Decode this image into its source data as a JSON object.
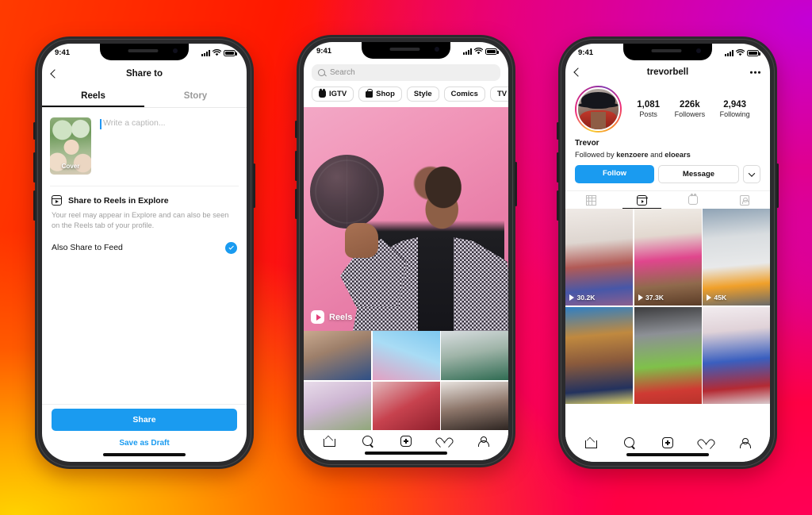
{
  "background": {
    "colors": [
      "#ff3b00",
      "#ff1800",
      "#fa0050",
      "#e5009a",
      "#bc00d4",
      "#ffd200"
    ]
  },
  "accent": {
    "blue": "#1a9bf0",
    "ig_gradient": [
      "#f9ce34",
      "#ee2a7b",
      "#bc2a8d",
      "#8134af",
      "#f58529"
    ]
  },
  "status_bar": {
    "time": "9:41",
    "signal_icon": "cellular-bars-icon",
    "wifi_icon": "wifi-icon",
    "battery_icon": "battery-icon"
  },
  "phone1": {
    "nav": {
      "back_icon": "chevron-left-icon",
      "title": "Share to"
    },
    "tabs": [
      {
        "label": "Reels",
        "active": true
      },
      {
        "label": "Story",
        "active": false
      }
    ],
    "composer": {
      "cover_label": "Cover",
      "caption_placeholder": "Write a caption...",
      "caption_value": ""
    },
    "explore": {
      "icon": "reels-icon",
      "title": "Share to Reels in Explore",
      "description": "Your reel may appear in Explore and can also be seen on the Reels tab of your profile."
    },
    "feed_option": {
      "label": "Also Share to Feed",
      "checked": true,
      "check_icon": "check-circle-icon"
    },
    "actions": {
      "primary": "Share",
      "secondary": "Save as Draft"
    }
  },
  "phone2": {
    "search": {
      "placeholder": "Search",
      "value": "",
      "icon": "search-icon"
    },
    "chips": [
      {
        "label": "IGTV",
        "icon": "igtv-icon"
      },
      {
        "label": "Shop",
        "icon": "shopping-bag-icon"
      },
      {
        "label": "Style",
        "icon": ""
      },
      {
        "label": "Comics",
        "icon": ""
      },
      {
        "label": "TV & Movies",
        "icon": ""
      }
    ],
    "hero": {
      "badge_label": "Reels",
      "badge_icon": "reels-icon",
      "alt": "person spinning a basketball on a pink background"
    },
    "explore_grid": [
      {
        "alt": "two people writing at a table"
      },
      {
        "alt": "hand with rainbow glitter against blue sky"
      },
      {
        "alt": "person in green beanie and sunglasses"
      },
      {
        "alt": "pastel flower arrangement"
      },
      {
        "alt": "red fabric close up"
      },
      {
        "alt": "portrait in low light"
      }
    ],
    "navbar": [
      {
        "icon": "home-icon",
        "label": "Home"
      },
      {
        "icon": "search-icon",
        "label": "Search"
      },
      {
        "icon": "plus-square-icon",
        "label": "Create"
      },
      {
        "icon": "heart-icon",
        "label": "Activity"
      },
      {
        "icon": "person-icon",
        "label": "Profile"
      }
    ]
  },
  "phone3": {
    "nav": {
      "back_icon": "chevron-left-icon",
      "username": "trevorbell",
      "menu_icon": "more-options-icon"
    },
    "avatar": {
      "alt": "man in black cowboy hat and red shirt",
      "has_story_ring": true
    },
    "stats": [
      {
        "number": "1,081",
        "caption": "Posts"
      },
      {
        "number": "226k",
        "caption": "Followers"
      },
      {
        "number": "2,943",
        "caption": "Following"
      }
    ],
    "display_name": "Trevor",
    "followed_by": {
      "prefix": "Followed by ",
      "first": "kenzoere",
      "joiner": " and ",
      "second": "eloears"
    },
    "buttons": {
      "follow": "Follow",
      "message": "Message",
      "more_icon": "chevron-down-icon"
    },
    "tabs": [
      {
        "icon": "grid-icon",
        "active": false
      },
      {
        "icon": "reels-icon",
        "active": true
      },
      {
        "icon": "igtv-icon",
        "active": false
      },
      {
        "icon": "tagged-icon",
        "active": false
      }
    ],
    "reels": [
      {
        "views": "30.2K",
        "alt": "person in spiderman costume in hallway"
      },
      {
        "views": "37.3K",
        "alt": "group workout dance in a home gym"
      },
      {
        "views": "45K",
        "alt": "city bus on a street with fire effect"
      },
      {
        "views": "",
        "alt": "young man talking to camera"
      },
      {
        "views": "",
        "alt": "man jumping on gym boxes"
      },
      {
        "views": "",
        "alt": "person in superman costume"
      }
    ],
    "navbar": [
      {
        "icon": "home-icon",
        "label": "Home"
      },
      {
        "icon": "search-icon",
        "label": "Search"
      },
      {
        "icon": "plus-square-icon",
        "label": "Create"
      },
      {
        "icon": "heart-icon",
        "label": "Activity"
      },
      {
        "icon": "person-icon",
        "label": "Profile"
      }
    ]
  }
}
